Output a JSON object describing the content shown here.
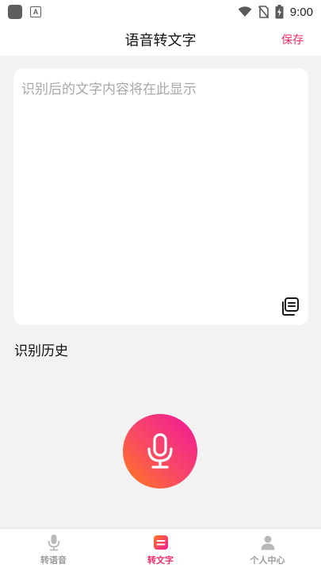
{
  "status_bar": {
    "time": "9:00",
    "icons": [
      "app-icon",
      "a-notification-icon",
      "wifi-icon",
      "no-sim-icon",
      "battery-charging-icon"
    ]
  },
  "header": {
    "title": "语音转文字",
    "save_label": "保存"
  },
  "editor": {
    "placeholder": "识别后的文字内容将在此显示",
    "value": "",
    "copy_icon": "copy-icon"
  },
  "history": {
    "label": "识别历史"
  },
  "record": {
    "icon": "microphone-icon"
  },
  "nav": {
    "items": [
      {
        "label": "转语音",
        "icon": "microphone-icon",
        "active": false
      },
      {
        "label": "转文字",
        "icon": "text-doc-icon",
        "active": true
      },
      {
        "label": "个人中心",
        "icon": "person-icon",
        "active": false
      }
    ]
  },
  "colors": {
    "accent": "#ee2a6a",
    "gradient_start": "#ff7a1a",
    "gradient_end": "#f0169a",
    "background": "#f2f2f2",
    "inactive": "#9a9a9a"
  }
}
